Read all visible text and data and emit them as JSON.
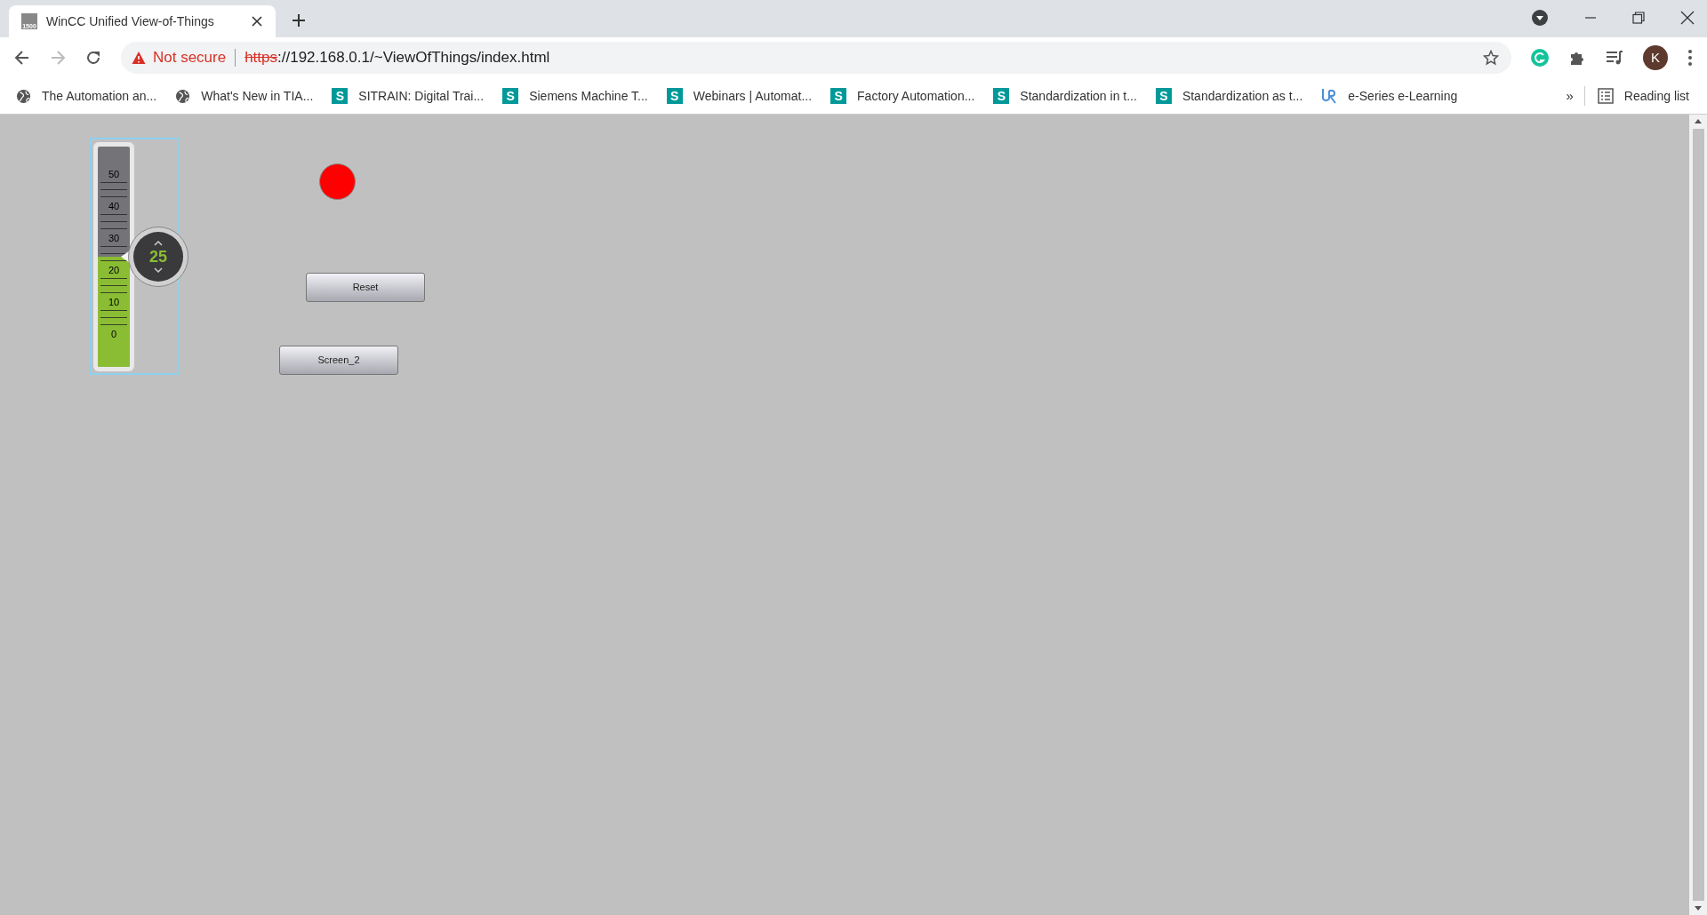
{
  "tab": {
    "title": "WinCC Unified View-of-Things",
    "icon_text": "1500"
  },
  "address_bar": {
    "security": "Not secure",
    "scheme": "https",
    "url_rest": "://192.168.0.1/~ViewOfThings/index.html"
  },
  "profile": {
    "initial": "K"
  },
  "bookmarks": [
    {
      "kind": "globe",
      "label": "The Automation an..."
    },
    {
      "kind": "globe",
      "label": "What's New in TIA..."
    },
    {
      "kind": "letter",
      "label": "SITRAIN: Digital Trai...",
      "badge": "S"
    },
    {
      "kind": "letter",
      "label": "Siemens Machine T...",
      "badge": "S"
    },
    {
      "kind": "letter",
      "label": "Webinars | Automat...",
      "badge": "S"
    },
    {
      "kind": "letter",
      "label": "Factory Automation...",
      "badge": "S"
    },
    {
      "kind": "letter",
      "label": "Standardization in t...",
      "badge": "S"
    },
    {
      "kind": "letter",
      "label": "Standardization as t...",
      "badge": "S"
    },
    {
      "kind": "ur",
      "label": "e-Series e-Learning"
    }
  ],
  "bookmarks_overflow": "»",
  "reading_list": "Reading list",
  "hmi": {
    "slider": {
      "scale": [
        "50",
        "40",
        "30",
        "20",
        "10",
        "0"
      ],
      "level": 0.5,
      "value": "25"
    },
    "indicator": {
      "color": "#ff0000"
    },
    "buttons": [
      {
        "label": "Reset"
      },
      {
        "label": "Screen_2"
      }
    ]
  }
}
